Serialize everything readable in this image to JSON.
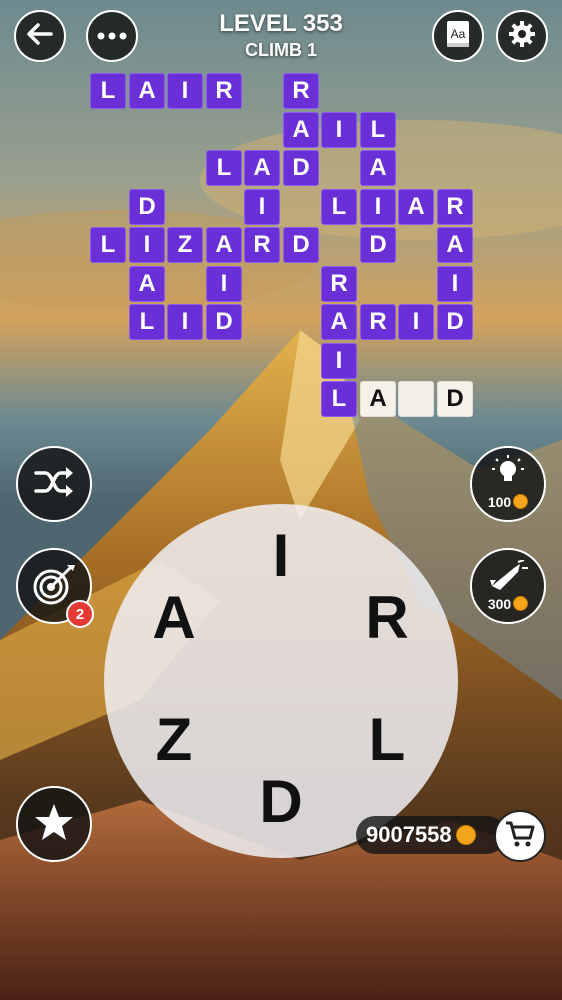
{
  "header": {
    "level": "LEVEL 353",
    "subtitle": "CLIMB 1"
  },
  "grid": {
    "cells": [
      {
        "r": 0,
        "c": 2,
        "l": "L",
        "s": "filled"
      },
      {
        "r": 0,
        "c": 3,
        "l": "A",
        "s": "filled"
      },
      {
        "r": 0,
        "c": 4,
        "l": "I",
        "s": "filled"
      },
      {
        "r": 0,
        "c": 5,
        "l": "R",
        "s": "filled"
      },
      {
        "r": 0,
        "c": 7,
        "l": "R",
        "s": "filled"
      },
      {
        "r": 1,
        "c": 7,
        "l": "A",
        "s": "filled"
      },
      {
        "r": 1,
        "c": 8,
        "l": "I",
        "s": "filled"
      },
      {
        "r": 1,
        "c": 9,
        "l": "L",
        "s": "filled"
      },
      {
        "r": 2,
        "c": 5,
        "l": "L",
        "s": "filled"
      },
      {
        "r": 2,
        "c": 6,
        "l": "A",
        "s": "filled"
      },
      {
        "r": 2,
        "c": 7,
        "l": "D",
        "s": "filled"
      },
      {
        "r": 2,
        "c": 9,
        "l": "A",
        "s": "filled"
      },
      {
        "r": 3,
        "c": 3,
        "l": "D",
        "s": "filled"
      },
      {
        "r": 3,
        "c": 6,
        "l": "I",
        "s": "filled"
      },
      {
        "r": 3,
        "c": 8,
        "l": "L",
        "s": "filled"
      },
      {
        "r": 3,
        "c": 9,
        "l": "I",
        "s": "filled"
      },
      {
        "r": 3,
        "c": 10,
        "l": "A",
        "s": "filled"
      },
      {
        "r": 3,
        "c": 11,
        "l": "R",
        "s": "filled"
      },
      {
        "r": 4,
        "c": 2,
        "l": "L",
        "s": "filled"
      },
      {
        "r": 4,
        "c": 3,
        "l": "I",
        "s": "filled"
      },
      {
        "r": 4,
        "c": 4,
        "l": "Z",
        "s": "filled"
      },
      {
        "r": 4,
        "c": 5,
        "l": "A",
        "s": "filled"
      },
      {
        "r": 4,
        "c": 6,
        "l": "R",
        "s": "filled"
      },
      {
        "r": 4,
        "c": 7,
        "l": "D",
        "s": "filled"
      },
      {
        "r": 4,
        "c": 9,
        "l": "D",
        "s": "filled"
      },
      {
        "r": 4,
        "c": 11,
        "l": "A",
        "s": "filled"
      },
      {
        "r": 5,
        "c": 3,
        "l": "A",
        "s": "filled"
      },
      {
        "r": 5,
        "c": 5,
        "l": "I",
        "s": "filled"
      },
      {
        "r": 5,
        "c": 8,
        "l": "R",
        "s": "filled"
      },
      {
        "r": 5,
        "c": 11,
        "l": "I",
        "s": "filled"
      },
      {
        "r": 6,
        "c": 3,
        "l": "L",
        "s": "filled"
      },
      {
        "r": 6,
        "c": 4,
        "l": "I",
        "s": "filled"
      },
      {
        "r": 6,
        "c": 5,
        "l": "D",
        "s": "filled"
      },
      {
        "r": 6,
        "c": 8,
        "l": "A",
        "s": "filled"
      },
      {
        "r": 6,
        "c": 9,
        "l": "R",
        "s": "filled"
      },
      {
        "r": 6,
        "c": 10,
        "l": "I",
        "s": "filled"
      },
      {
        "r": 6,
        "c": 11,
        "l": "D",
        "s": "filled"
      },
      {
        "r": 7,
        "c": 8,
        "l": "I",
        "s": "filled"
      },
      {
        "r": 8,
        "c": 8,
        "l": "L",
        "s": "filled"
      },
      {
        "r": 8,
        "c": 9,
        "l": "A",
        "s": "hint"
      },
      {
        "r": 8,
        "c": 10,
        "l": "",
        "s": "empty"
      },
      {
        "r": 8,
        "c": 11,
        "l": "D",
        "s": "hint"
      }
    ]
  },
  "wheel": {
    "letters": [
      "I",
      "R",
      "L",
      "D",
      "Z",
      "A"
    ]
  },
  "buttons": {
    "hint_cost": "100",
    "rocket_cost": "300",
    "target_badge": "2"
  },
  "coins": "9007558",
  "icons": [
    "back-arrow-icon",
    "more-dots-icon",
    "dictionary-icon",
    "gear-icon",
    "shuffle-icon",
    "target-icon",
    "star-icon",
    "lightbulb-icon",
    "rocket-icon",
    "cart-icon",
    "coin-icon"
  ],
  "colors": {
    "tile_purple": "#6a2fd6",
    "tile_hint": "#f6f2ea",
    "badge_red": "#e53935",
    "coin_gold": "#f4a51c"
  }
}
